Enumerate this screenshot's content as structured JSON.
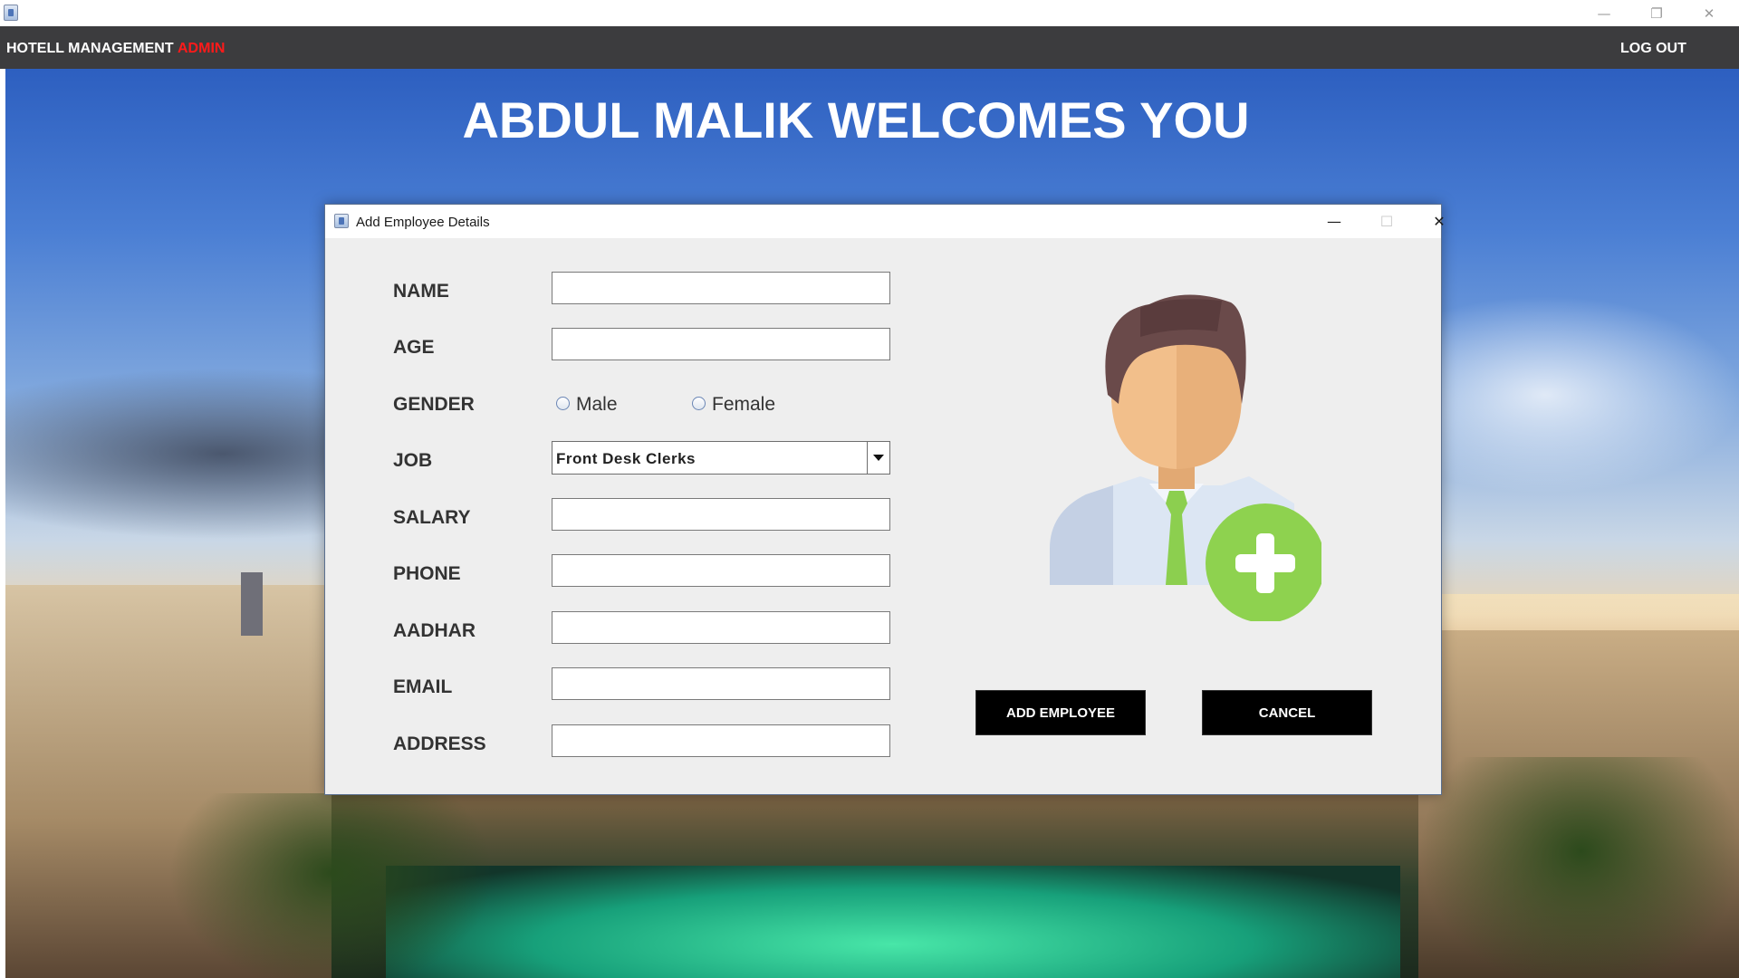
{
  "window": {
    "minimize_glyph": "—",
    "restore_glyph": "❐",
    "close_glyph": "✕"
  },
  "menubar": {
    "brand": "HOTELL MANAGEMENT",
    "role": "ADMIN",
    "logout": "LOG OUT"
  },
  "welcome": "ABDUL MALIK WELCOMES YOU",
  "dialog": {
    "title": "Add Employee Details",
    "minimize_glyph": "—",
    "maximize_glyph": "☐",
    "close_glyph": "✕",
    "fields": {
      "name": {
        "label": "NAME",
        "value": ""
      },
      "age": {
        "label": "AGE",
        "value": ""
      },
      "gender": {
        "label": "GENDER",
        "options": [
          "Male",
          "Female"
        ],
        "selected": null
      },
      "job": {
        "label": "JOB",
        "selected": "Front Desk Clerks"
      },
      "salary": {
        "label": "SALARY",
        "value": ""
      },
      "phone": {
        "label": "PHONE",
        "value": ""
      },
      "aadhar": {
        "label": "AADHAR",
        "value": ""
      },
      "email": {
        "label": "EMAIL",
        "value": ""
      },
      "address": {
        "label": "ADDRESS",
        "value": ""
      }
    },
    "buttons": {
      "add": "ADD EMPLOYEE",
      "cancel": "CANCEL"
    },
    "illustration": "add-user-icon"
  },
  "colors": {
    "menubar_bg": "#3c3c3e",
    "role_text": "#ff1a1a",
    "button_bg": "#000000",
    "dialog_bg": "#eeeeee",
    "plus_green": "#8ed24f"
  }
}
